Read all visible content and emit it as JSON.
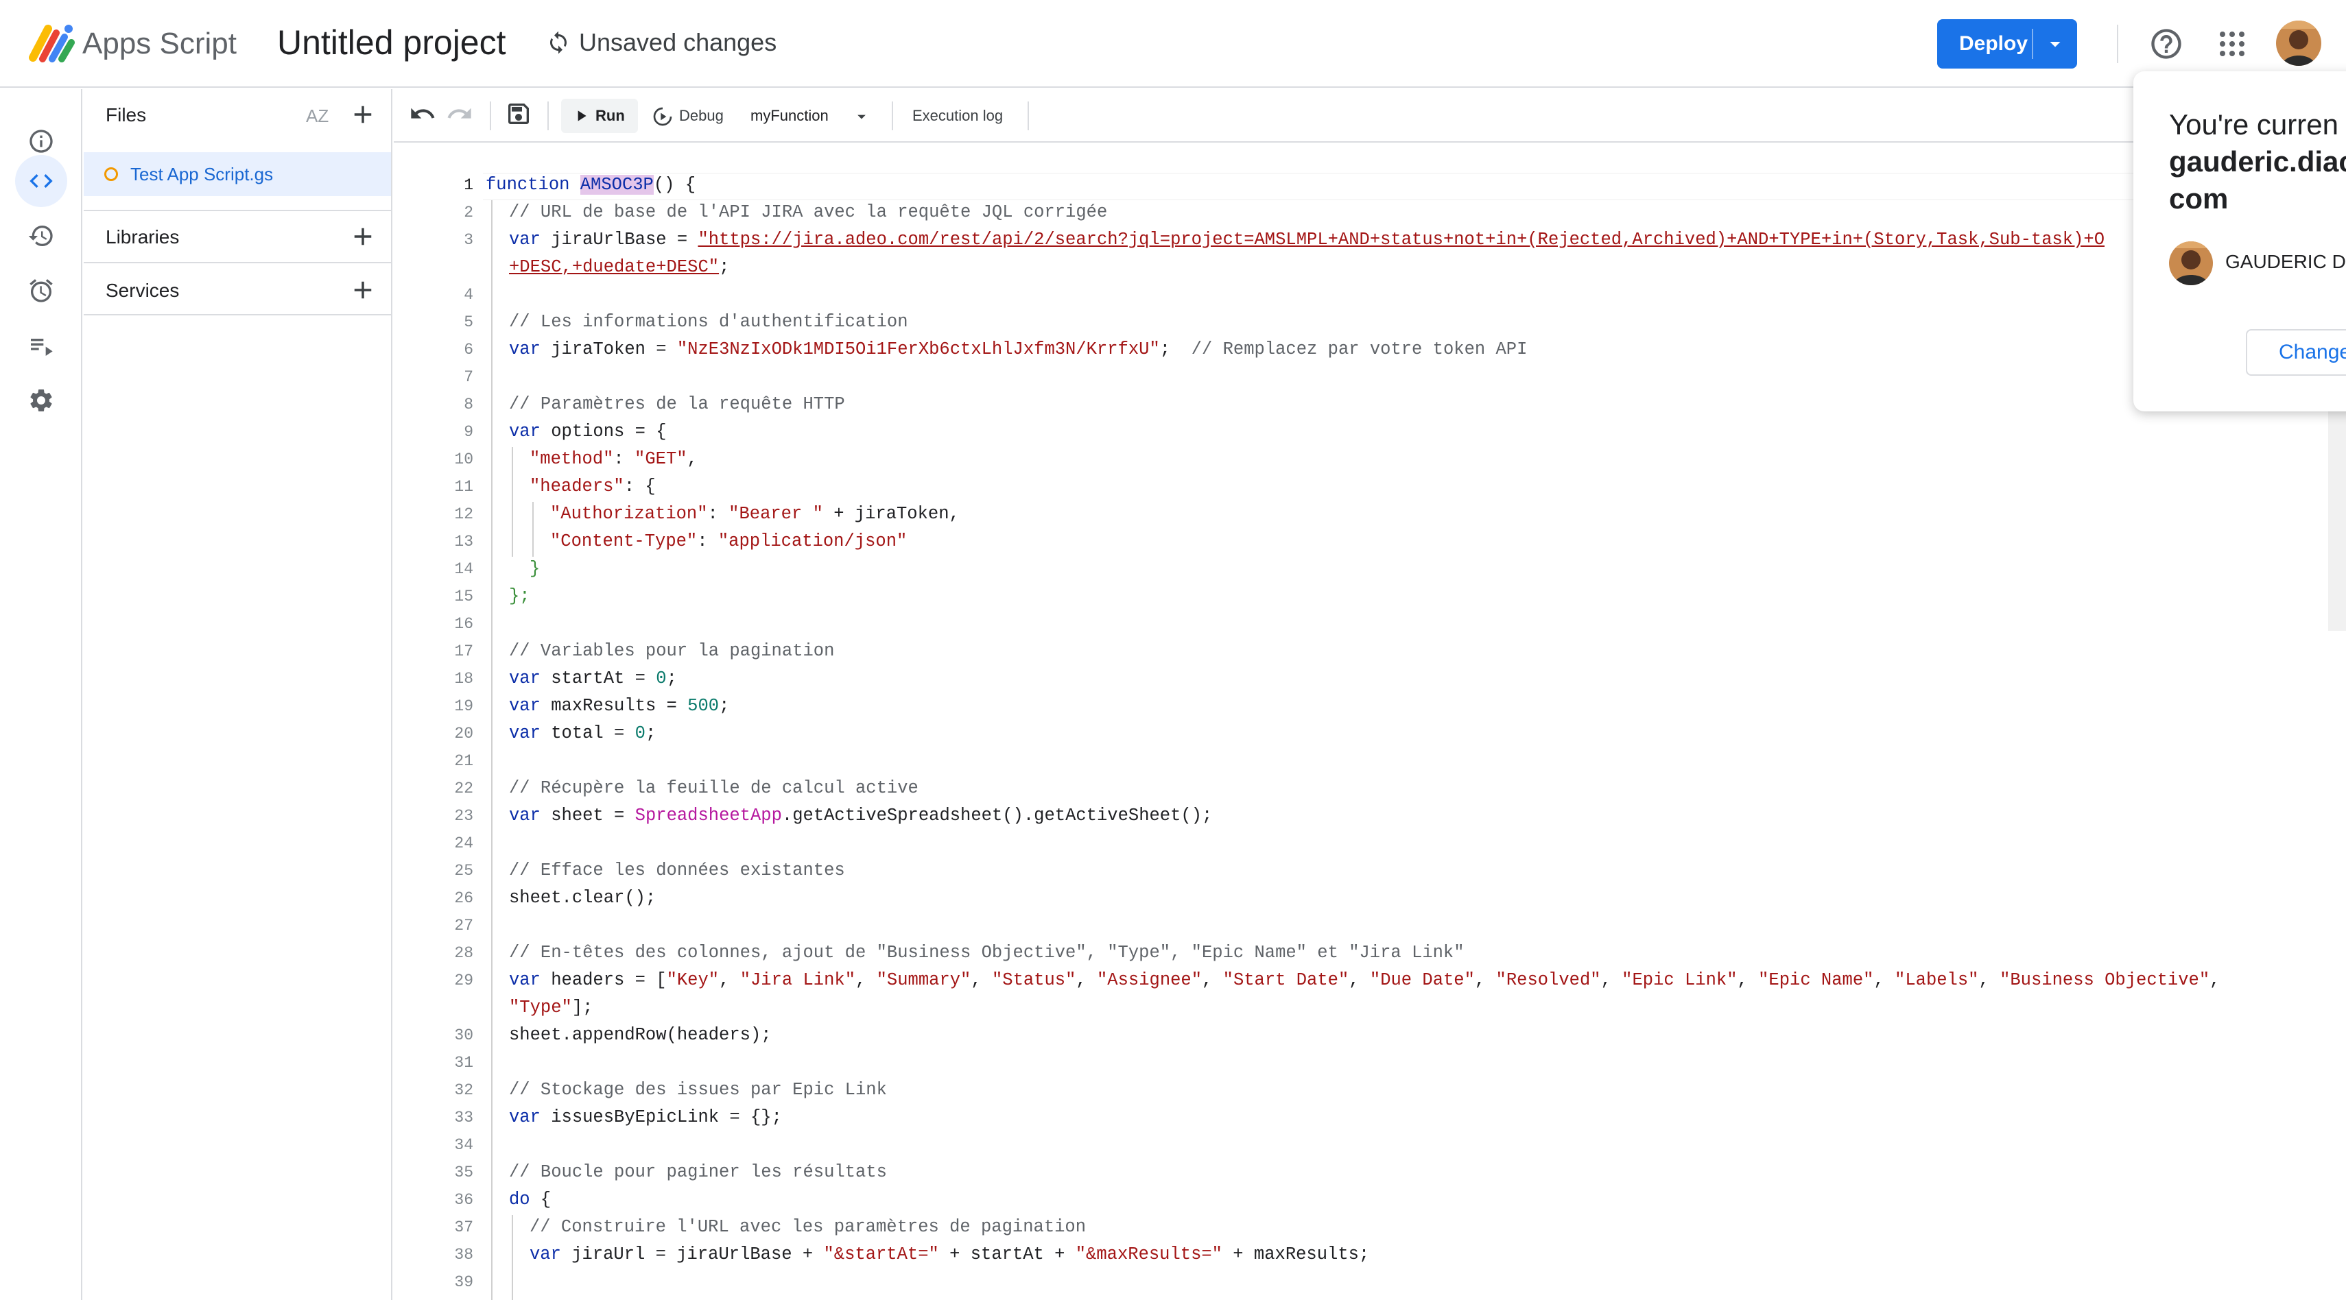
{
  "header": {
    "app_name": "Apps Script",
    "project_title": "Untitled project",
    "save_status": "Unsaved changes",
    "deploy_label": "Deploy"
  },
  "rail": {
    "items": [
      "overview-icon",
      "editor-icon",
      "executions-icon",
      "triggers-icon",
      "executions-list-icon",
      "settings-icon"
    ]
  },
  "files_panel": {
    "title": "Files",
    "sort_icon_text": "AZ",
    "files": [
      {
        "name": "Test App Script.gs"
      }
    ],
    "libraries_label": "Libraries",
    "services_label": "Services"
  },
  "toolbar": {
    "run_label": "Run",
    "debug_label": "Debug",
    "function_name": "myFunction",
    "execution_log_label": "Execution log"
  },
  "editor": {
    "line_numbers": [
      "1",
      "2",
      "3",
      "4",
      "5",
      "6",
      "7",
      "8",
      "9",
      "10",
      "11",
      "12",
      "13",
      "14",
      "15",
      "16",
      "17",
      "18",
      "19",
      "20",
      "21",
      "22",
      "23",
      "24",
      "25",
      "26",
      "27",
      "28",
      "29",
      "30",
      "31",
      "32",
      "33",
      "34",
      "35",
      "36",
      "37",
      "38",
      "39"
    ],
    "code": {
      "l1": "function AMSOC3P() {",
      "l2": "// URL de base de l'API JIRA avec la requête JQL corrigée",
      "l3a": "var jiraUrlBase = \"https://jira.adeo.com/rest/api/2/search?jql=project=AMSLMPL+AND+status+not+in+(Rejected,Archived)+AND+TYPE+in+(Story,Task,Sub-task)+O",
      "l3b": "+DESC,+duedate+DESC\";",
      "l5": "// Les informations d'authentification",
      "l6": "var jiraToken = \"NzE3NzIxODk1MDI5Oi1FerXb6ctxLhlJxfm3N/KrrfxU\";  // Remplacez par votre token API",
      "l8": "// Paramètres de la requête HTTP",
      "l9": "var options = {",
      "l10": "\"method\": \"GET\",",
      "l11": "\"headers\": {",
      "l12": "\"Authorization\": \"Bearer \" + jiraToken,",
      "l13": "\"Content-Type\": \"application/json\"",
      "l14": "}",
      "l15": "};",
      "l17": "// Variables pour la pagination",
      "l18": "var startAt = 0;",
      "l19": "var maxResults = 500;",
      "l20": "var total = 0;",
      "l22": "// Récupère la feuille de calcul active",
      "l23": "var sheet = SpreadsheetApp.getActiveSpreadsheet().getActiveSheet();",
      "l25": "// Efface les données existantes",
      "l26": "sheet.clear();",
      "l28": "// En-têtes des colonnes, ajout de \"Business Objective\", \"Type\", \"Epic Name\" et \"Jira Link\"",
      "l29a": "var headers = [\"Key\", \"Jira Link\", \"Summary\", \"Status\", \"Assignee\", \"Start Date\", \"Due Date\", \"Resolved\", \"Epic Link\", \"Epic Name\", \"Labels\", \"Business Objective\",",
      "l29b": "\"Type\"];",
      "l30": "sheet.appendRow(headers);",
      "l32": "// Stockage des issues par Epic Link",
      "l33": "var issuesByEpicLink = {};",
      "l35": "// Boucle pour paginer les résultats",
      "l36": "do {",
      "l37": "// Construire l'URL avec les paramètres de pagination",
      "l38": "var jiraUrl = jiraUrlBase + \"&startAt=\" + startAt + \"&maxResults=\" + maxResults;"
    }
  },
  "account_popup": {
    "line1": "You're curren",
    "line2": "gauderic.diac",
    "line3": "com",
    "name": "GAUDERIC DI",
    "change_label": "Change"
  },
  "colors": {
    "accent": "#1a73e8",
    "keyword": "#0b2da8",
    "string": "#a31515",
    "comment": "#5f6368",
    "number": "#0a7a6b",
    "class": "#b5179e"
  }
}
